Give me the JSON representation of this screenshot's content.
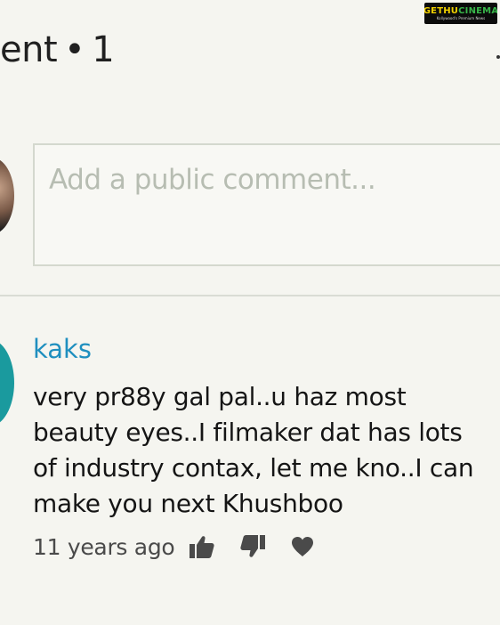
{
  "watermark": {
    "brand_primary": "GETHU",
    "brand_secondary": "CINEMA",
    "tagline": "Kollywood's Premium News"
  },
  "header": {
    "title_fragment": "ent",
    "separator": "•",
    "count": "1"
  },
  "composer": {
    "placeholder": "Add a public comment..."
  },
  "comments": [
    {
      "author": "kaks",
      "text": "very pr88y gal pal..u haz most\nbeauty eyes..I filmaker dat has lots\nof industry contax, let me kno..I can\nmake you next Khushboo",
      "timestamp": "11 years ago",
      "actions": {
        "like_icon": "thumbs-up-icon",
        "dislike_icon": "thumbs-down-icon",
        "heart_icon": "heart-icon"
      }
    }
  ],
  "colors": {
    "background": "#f5f5f0",
    "author_link": "#1f8fbf",
    "avatar_teal": "#1a9a9e",
    "icon_gray": "#4a4a4a",
    "placeholder": "#b7bdb2",
    "border": "#d4d8ce"
  }
}
